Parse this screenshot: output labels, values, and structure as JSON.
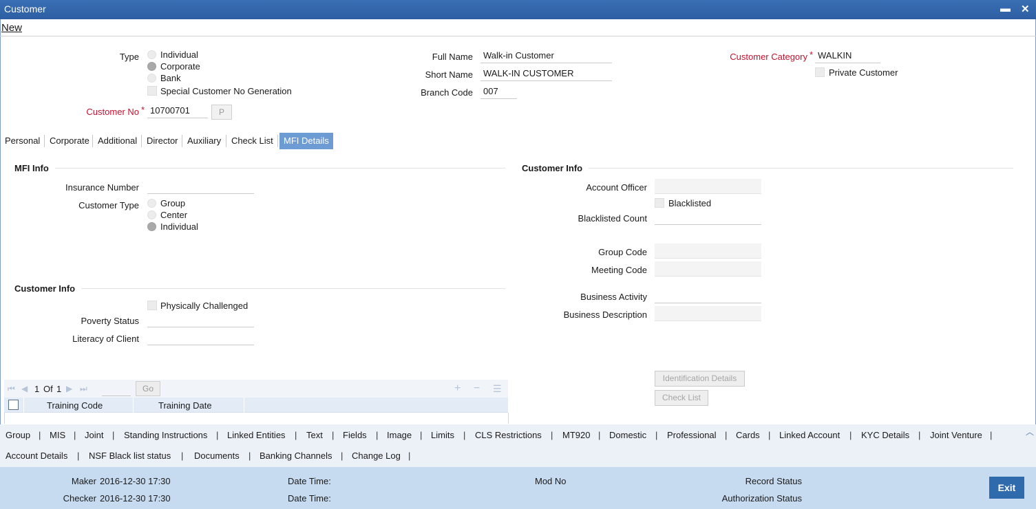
{
  "window": {
    "title": "Customer",
    "minimize": "▬",
    "close": "✕"
  },
  "menu": {
    "new": "New"
  },
  "header": {
    "type_label": "Type",
    "type_options": [
      "Individual",
      "Corporate",
      "Bank"
    ],
    "type_selected": "Corporate",
    "special_no_label": "Special Customer No Generation",
    "customer_no_label": "Customer No",
    "required_mark": "*",
    "customer_no": "10700701",
    "p_button": "P",
    "full_name_label": "Full Name",
    "full_name": "Walk-in Customer",
    "short_name_label": "Short Name",
    "short_name": "WALK-IN CUSTOMER",
    "branch_code_label": "Branch Code",
    "branch_code": "007",
    "category_label": "Customer Category",
    "category": "WALKIN",
    "private_label": "Private Customer"
  },
  "tabs": [
    "Personal",
    "Corporate",
    "Additional",
    "Director",
    "Auxiliary",
    "Check List",
    "MFI Details"
  ],
  "active_tab": "MFI Details",
  "mfi_info": {
    "title": "MFI Info",
    "insurance_label": "Insurance Number",
    "insurance_value": "",
    "customer_type_label": "Customer Type",
    "customer_type_options": [
      "Group",
      "Center",
      "Individual"
    ],
    "customer_type_selected": "Individual"
  },
  "customer_info_left": {
    "title": "Customer Info",
    "physically_challenged_label": "Physically Challenged",
    "poverty_label": "Poverty Status",
    "literacy_label": "Literacy of Client"
  },
  "grid": {
    "page_current": "1",
    "page_of": "Of",
    "page_total": "1",
    "go_label": "Go",
    "columns": [
      "Training Code",
      "Training Date"
    ]
  },
  "customer_info_right": {
    "title": "Customer Info",
    "account_officer_label": "Account Officer",
    "blacklisted_label": "Blacklisted",
    "blacklisted_count_label": "Blacklisted Count",
    "group_code_label": "Group Code",
    "meeting_code_label": "Meeting Code",
    "business_activity_label": "Business Activity",
    "business_description_label": "Business Description",
    "identification_button": "Identification Details",
    "checklist_button": "Check List"
  },
  "links_row1": [
    "Group",
    "MIS",
    "Joint",
    "Standing Instructions",
    "Linked Entities",
    "Text",
    "Fields",
    "Image",
    "Limits",
    "CLS Restrictions",
    "MT920",
    "Domestic",
    "Professional",
    "Cards",
    "Linked Account",
    "KYC Details",
    "Joint Venture"
  ],
  "links_row2": [
    "Account Details",
    "NSF Black list status",
    "Documents",
    "Banking Channels",
    "Change Log"
  ],
  "separator": "|",
  "footer": {
    "maker_label": "Maker",
    "maker_value": "2016-12-30 17:30",
    "checker_label": "Checker",
    "checker_value": "2016-12-30 17:30",
    "date_time_label": "Date Time:",
    "mod_no_label": "Mod No",
    "record_status_label": "Record Status",
    "auth_status_label": "Authorization Status",
    "exit_label": "Exit"
  },
  "colors": {
    "titlebar": "#2d5ea3",
    "active_tab": "#6d9bd3",
    "required": "#c8102e",
    "footer": "#c6dbef",
    "exit": "#2f6aad"
  }
}
